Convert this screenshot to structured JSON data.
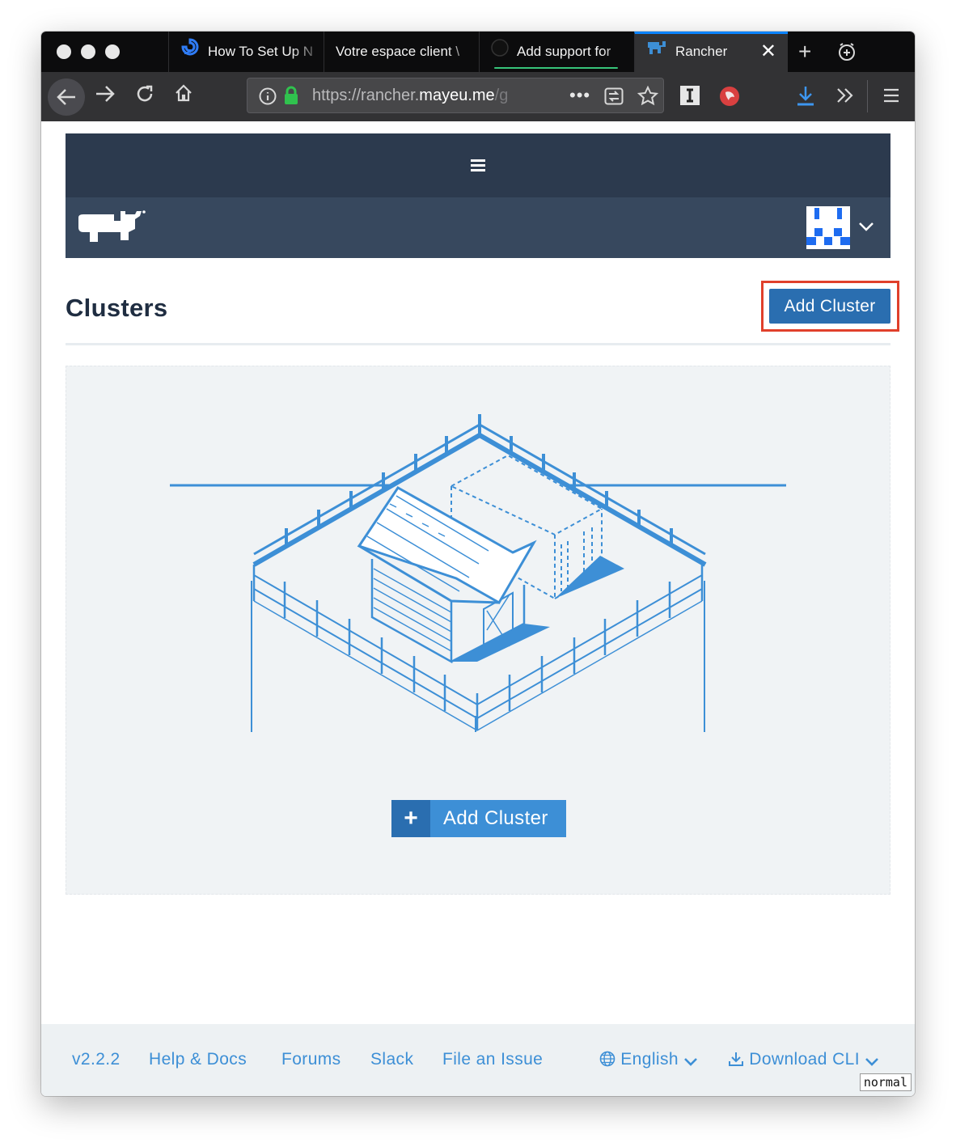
{
  "browser": {
    "tabs": [
      {
        "label": "How To Set Up N",
        "icon": "digitalocean-icon"
      },
      {
        "label": "Votre espace client \\",
        "icon": ""
      },
      {
        "label": "Add support for",
        "icon": "github-icon"
      },
      {
        "label": "Rancher",
        "icon": "rancher-tab-icon",
        "active": true
      }
    ],
    "url": {
      "prefix": "https://rancher.",
      "domain": "mayeu.me",
      "suffix": "/g"
    },
    "accent_color": "#0a84ff"
  },
  "rancher": {
    "header_bg": "#2c3a4e",
    "subheader_bg": "#37485e"
  },
  "page": {
    "title": "Clusters",
    "add_cluster_label": "Add Cluster",
    "empty_state": {
      "add_cluster_label": "Add Cluster",
      "plus": "+"
    },
    "primary_color": "#2a6eb0",
    "highlight_color": "#e0402b"
  },
  "footer": {
    "version": "v2.2.2",
    "help_docs": "Help & Docs",
    "forums": "Forums",
    "slack": "Slack",
    "file_issue": "File an Issue",
    "language": "English",
    "download_cli": "Download CLI",
    "mode_badge": "normal"
  }
}
